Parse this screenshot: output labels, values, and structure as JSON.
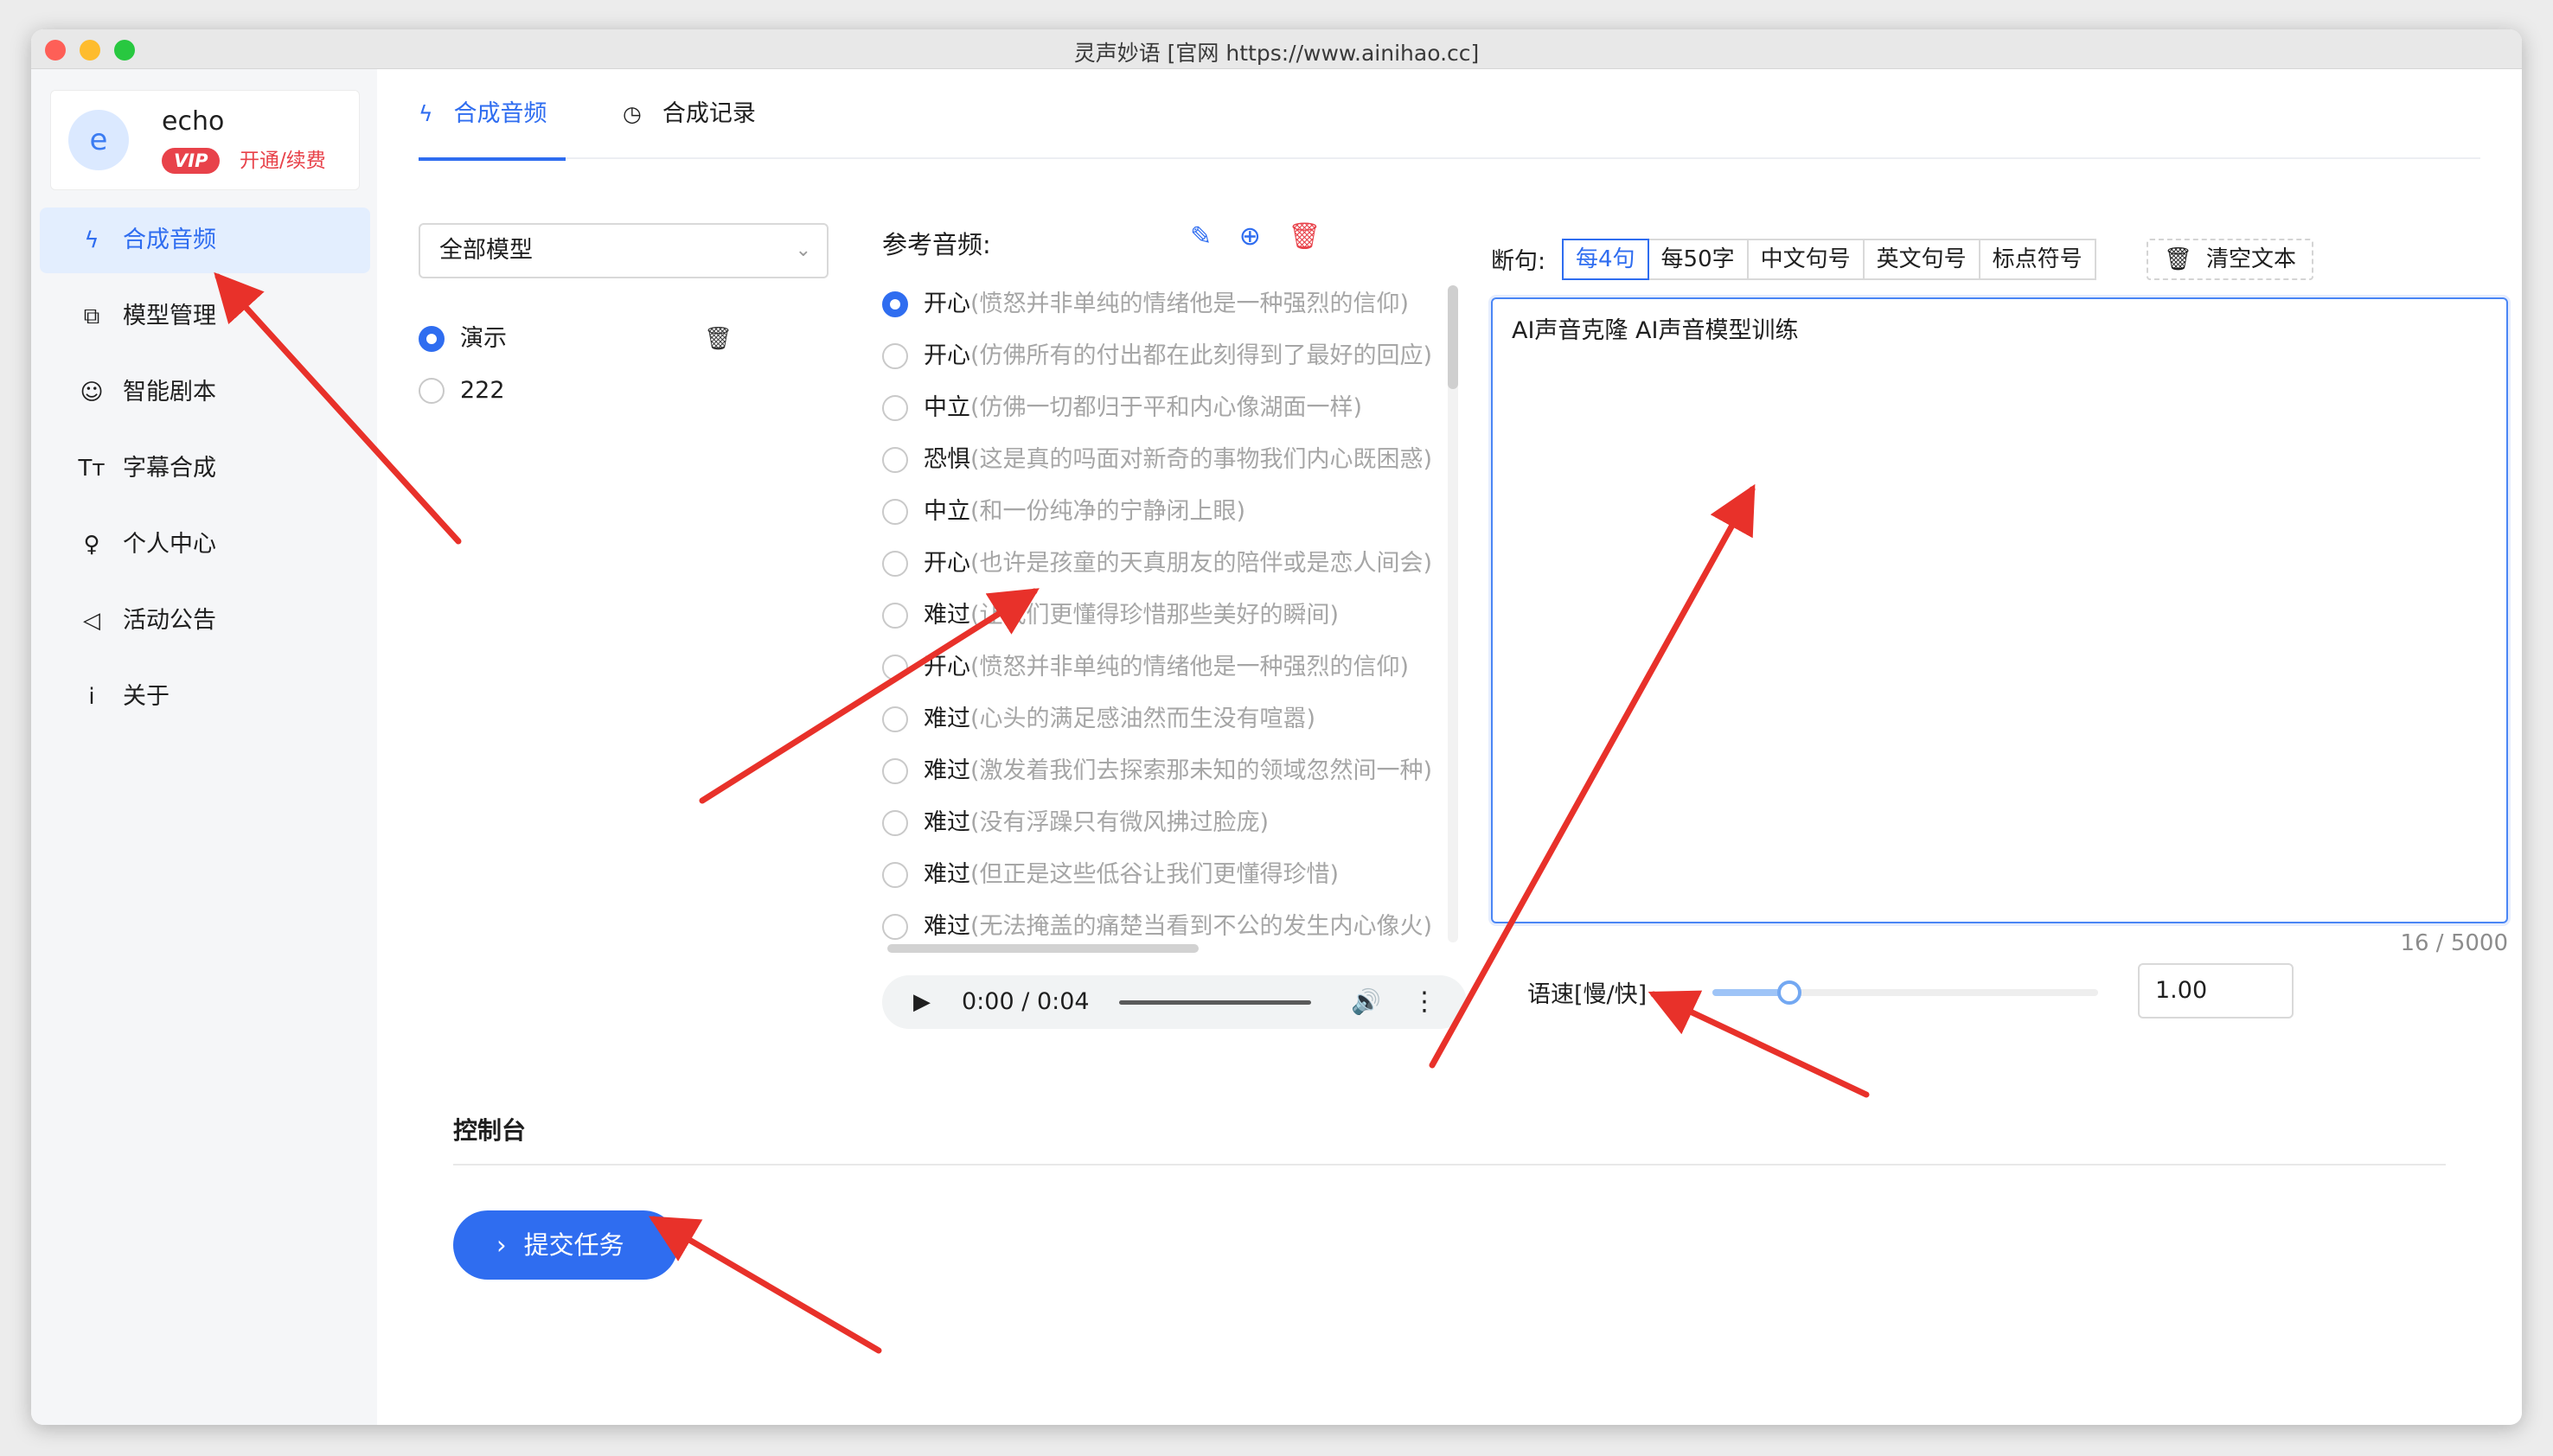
{
  "window": {
    "title": "灵声妙语 [官网 https://www.ainihao.cc]"
  },
  "user": {
    "avatar_letter": "e",
    "name": "echo",
    "vip_badge": "VIP",
    "renew_link": "开通/续费"
  },
  "sidebar": {
    "items": [
      {
        "icon": "lightning-icon",
        "glyph": "ϟ",
        "label": "合成音频",
        "active": true
      },
      {
        "icon": "model-icon",
        "glyph": "⧉",
        "label": "模型管理",
        "active": false
      },
      {
        "icon": "script-icon",
        "glyph": "☺",
        "label": "智能剧本",
        "active": false
      },
      {
        "icon": "text-size-icon",
        "glyph": "Tт",
        "label": "字幕合成",
        "active": false
      },
      {
        "icon": "user-icon",
        "glyph": "♀",
        "label": "个人中心",
        "active": false
      },
      {
        "icon": "megaphone-icon",
        "glyph": "◁",
        "label": "活动公告",
        "active": false
      },
      {
        "icon": "info-icon",
        "glyph": "i",
        "label": "关于",
        "active": false
      }
    ]
  },
  "tabs": [
    {
      "icon": "lightning-icon",
      "glyph": "ϟ",
      "label": "合成音频",
      "active": true
    },
    {
      "icon": "history-icon",
      "glyph": "◷",
      "label": "合成记录",
      "active": false
    }
  ],
  "models": {
    "select_value": "全部模型",
    "items": [
      {
        "name": "演示",
        "selected": true
      },
      {
        "name": "222",
        "selected": false
      }
    ]
  },
  "reference": {
    "title": "参考音频:",
    "items": [
      {
        "emotion": "开心",
        "text": "(愤怒并非单纯的情绪他是一种强烈的信仰)",
        "selected": true
      },
      {
        "emotion": "开心",
        "text": "(仿佛所有的付出都在此刻得到了最好的回应)",
        "selected": false
      },
      {
        "emotion": "中立",
        "text": "(仿佛一切都归于平和内心像湖面一样)",
        "selected": false
      },
      {
        "emotion": "恐惧",
        "text": "(这是真的吗面对新奇的事物我们内心既困惑)",
        "selected": false
      },
      {
        "emotion": "中立",
        "text": "(和一份纯净的宁静闭上眼)",
        "selected": false
      },
      {
        "emotion": "开心",
        "text": "(也许是孩童的天真朋友的陪伴或是恋人间会)",
        "selected": false
      },
      {
        "emotion": "难过",
        "text": "(让我们更懂得珍惜那些美好的瞬间)",
        "selected": false
      },
      {
        "emotion": "开心",
        "text": "(愤怒并非单纯的情绪他是一种强烈的信仰)",
        "selected": false
      },
      {
        "emotion": "难过",
        "text": "(心头的满足感油然而生没有喧嚣)",
        "selected": false
      },
      {
        "emotion": "难过",
        "text": "(激发着我们去探索那未知的领域忽然间一种)",
        "selected": false
      },
      {
        "emotion": "难过",
        "text": "(没有浮躁只有微风拂过脸庞)",
        "selected": false
      },
      {
        "emotion": "难过",
        "text": "(但正是这些低谷让我们更懂得珍惜)",
        "selected": false
      },
      {
        "emotion": "难过",
        "text": "(无法掩盖的痛楚当看到不公的发生内心像火)",
        "selected": false
      }
    ]
  },
  "player": {
    "current": "0:00",
    "separator": "/",
    "duration": "0:04"
  },
  "segmentation": {
    "label": "断句:",
    "options": [
      {
        "label": "每4句",
        "active": true
      },
      {
        "label": "每50字",
        "active": false
      },
      {
        "label": "中文句号",
        "active": false
      },
      {
        "label": "英文句号",
        "active": false
      },
      {
        "label": "标点符号",
        "active": false
      }
    ],
    "clear_label": "清空文本"
  },
  "editor": {
    "text": "AI声音克隆 AI声音模型训练",
    "count": "16 / 5000"
  },
  "speed": {
    "label": "语速[慢/快]",
    "value": "1.00",
    "slider_fraction": 0.2
  },
  "console": {
    "title": "控制台",
    "submit_label": "提交任务"
  },
  "colors": {
    "accent": "#2f6df0",
    "vip": "#e8424a",
    "arrow": "#e8312a"
  }
}
